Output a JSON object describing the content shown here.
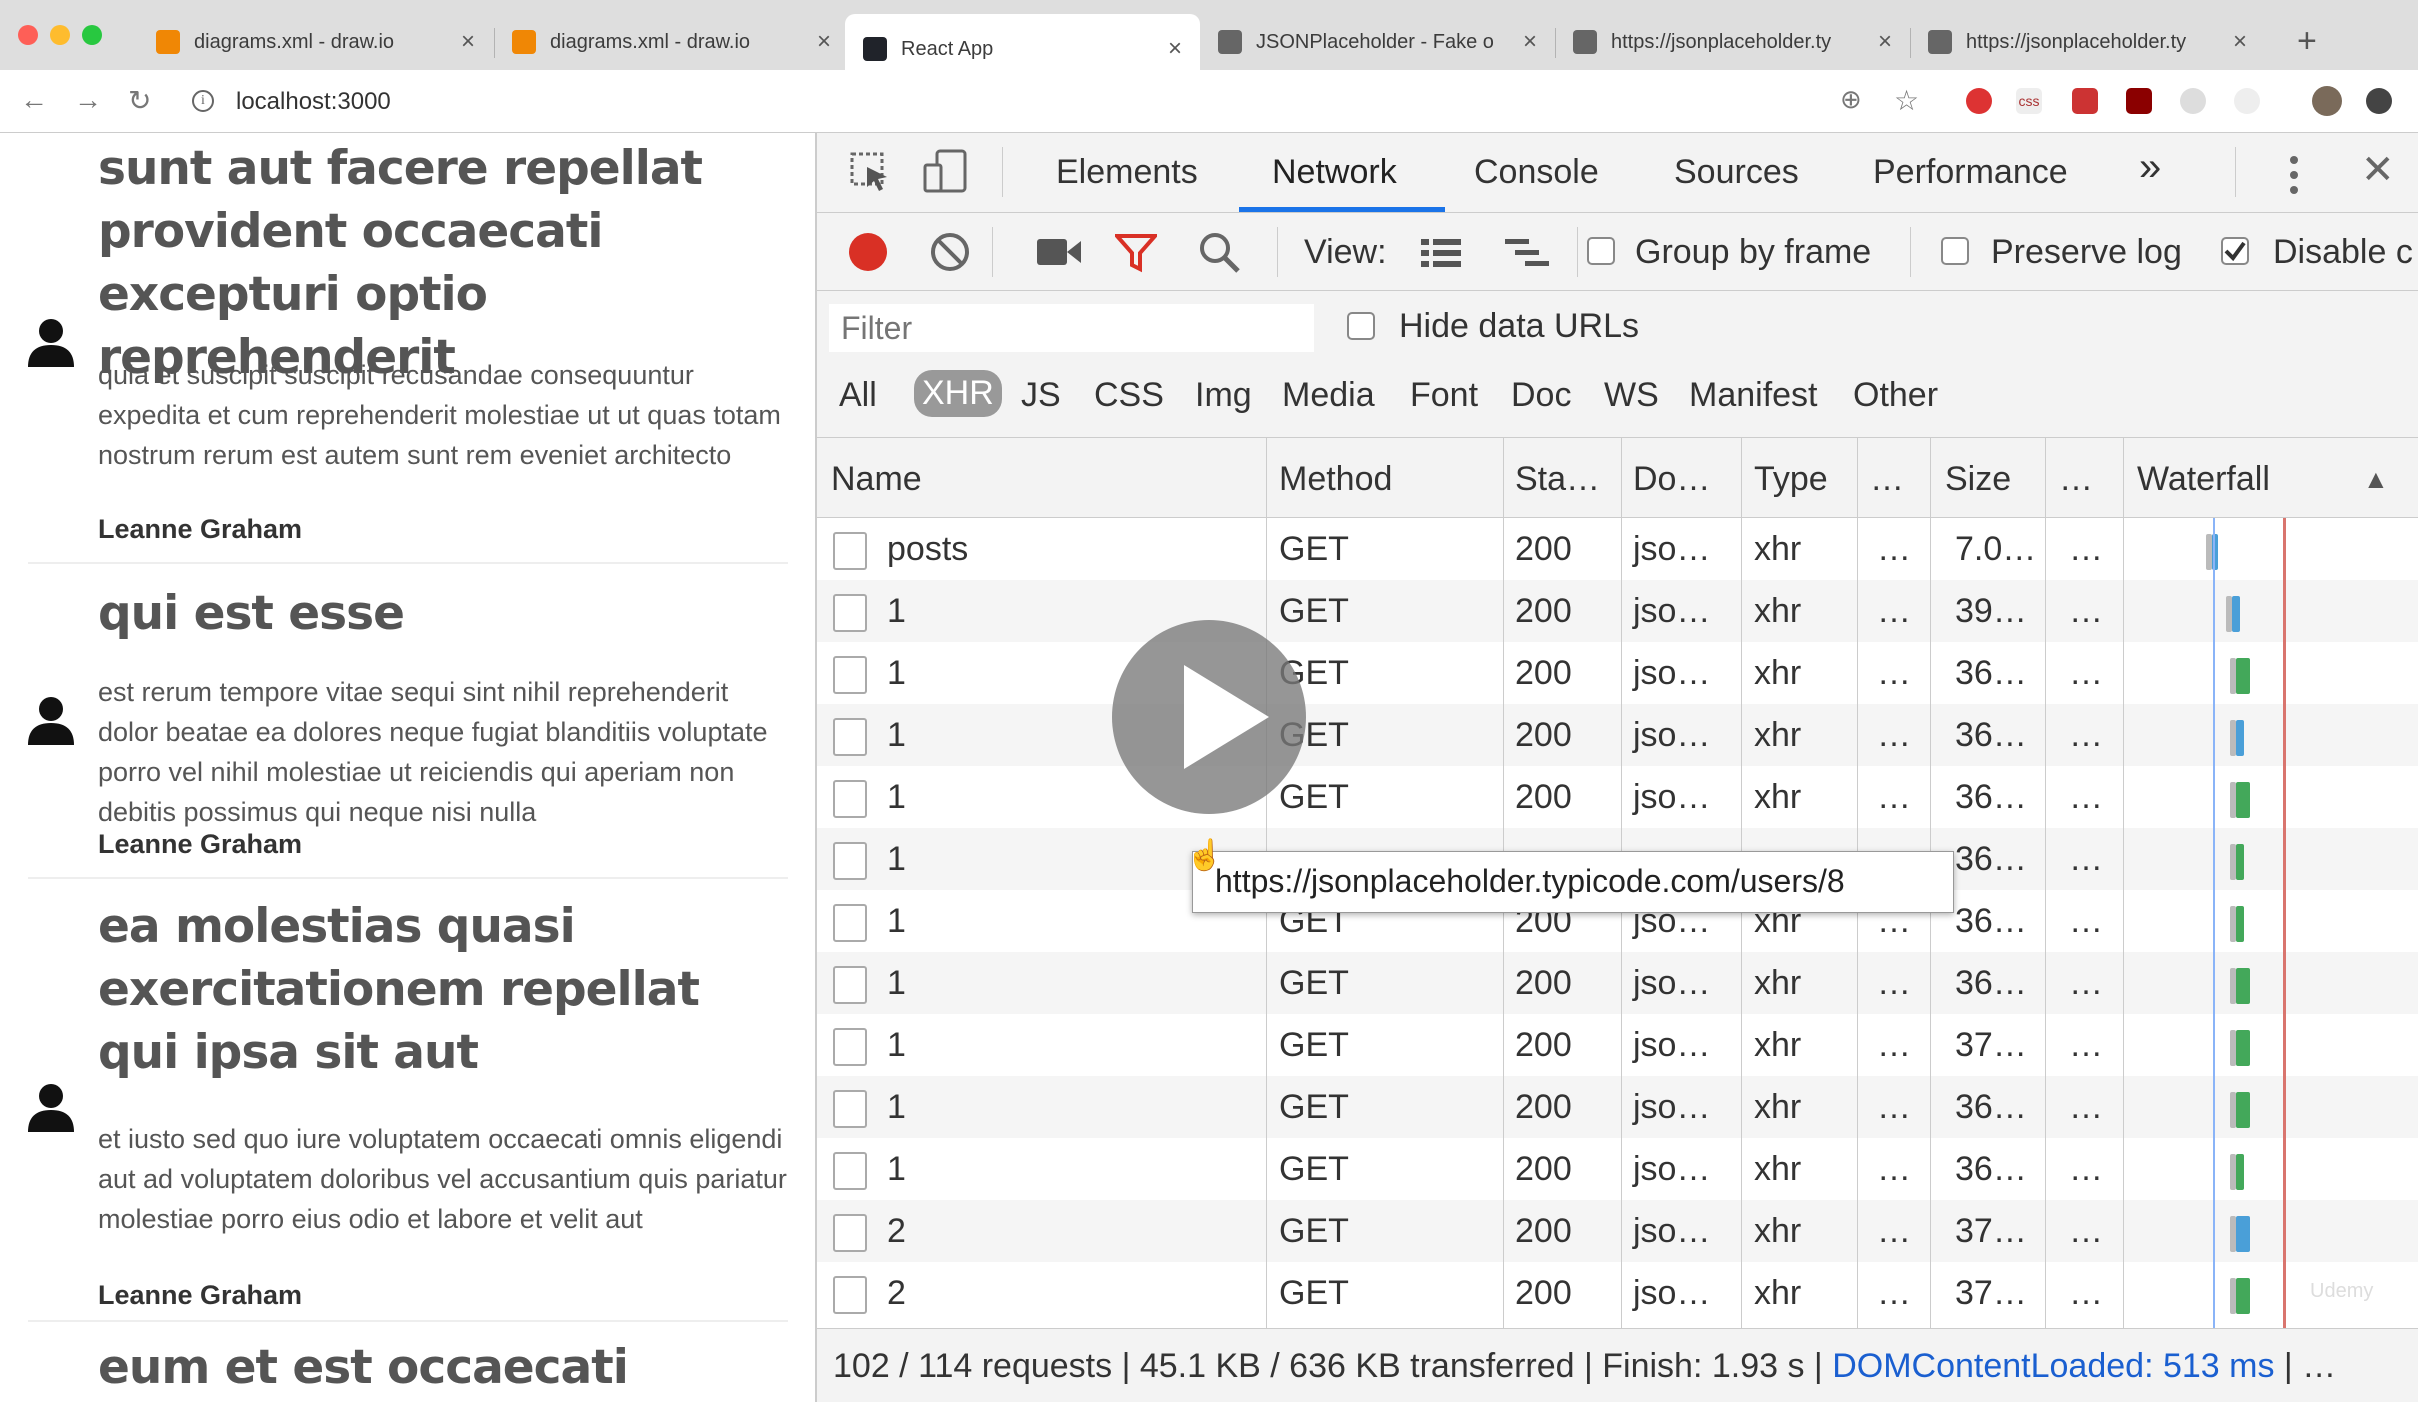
{
  "browser": {
    "tabs": [
      {
        "title": "diagrams.xml - draw.io",
        "icon": "drawio-icon",
        "color": "#f08705"
      },
      {
        "title": "diagrams.xml - draw.io",
        "icon": "drawio-icon",
        "color": "#f08705"
      },
      {
        "title": "React App",
        "icon": "react-icon",
        "color": "#20232a",
        "active": true
      },
      {
        "title": "JSONPlaceholder - Fake o",
        "icon": "placeholder-icon",
        "color": "#666"
      },
      {
        "title": "https://jsonplaceholder.ty",
        "icon": "placeholder-icon",
        "color": "#666"
      },
      {
        "title": "https://jsonplaceholder.ty",
        "icon": "placeholder-icon",
        "color": "#666"
      }
    ],
    "url": "localhost:3000"
  },
  "posts": [
    {
      "title": "sunt aut facere repellat provident occaecati excepturi optio reprehenderit",
      "body": "quia et suscipit suscipit recusandae consequuntur expedita et cum reprehenderit molestiae ut ut quas totam nostrum rerum est autem sunt rem eveniet architecto",
      "author": "Leanne Graham"
    },
    {
      "title": "qui est esse",
      "body": "est rerum tempore vitae sequi sint nihil reprehenderit dolor beatae ea dolores neque fugiat blanditiis voluptate porro vel nihil molestiae ut reiciendis qui aperiam non debitis possimus qui neque nisi nulla",
      "author": "Leanne Graham"
    },
    {
      "title": "ea molestias quasi exercitationem repellat qui ipsa sit aut",
      "body": "et iusto sed quo iure voluptatem occaecati omnis eligendi aut ad voluptatem doloribus vel accusantium quis pariatur molestiae porro eius odio et labore et velit aut",
      "author": "Leanne Graham"
    },
    {
      "title": "eum et est occaecati",
      "body": "",
      "author": ""
    }
  ],
  "devtools": {
    "tabs": [
      "Elements",
      "Network",
      "Console",
      "Sources",
      "Performance"
    ],
    "more": "»",
    "toolbar": {
      "view_label": "View:",
      "group_by_frame": "Group by frame",
      "preserve_log": "Preserve log",
      "disable_cache": "Disable c"
    },
    "filter_placeholder": "Filter",
    "hide_data_urls": "Hide data URLs",
    "types": [
      "All",
      "XHR",
      "JS",
      "CSS",
      "Img",
      "Media",
      "Font",
      "Doc",
      "WS",
      "Manifest",
      "Other"
    ],
    "columns": [
      "Name",
      "Method",
      "Sta…",
      "Do…",
      "Type",
      "…",
      "Size",
      "…",
      "Waterfall"
    ],
    "rows": [
      {
        "name": "posts",
        "method": "GET",
        "status": "200",
        "domain": "jso…",
        "type": "xhr",
        "c6": "…",
        "size": "7.0…",
        "c8": "…"
      },
      {
        "name": "1",
        "method": "GET",
        "status": "200",
        "domain": "jso…",
        "type": "xhr",
        "c6": "…",
        "size": "39…",
        "c8": "…"
      },
      {
        "name": "1",
        "method": "GET",
        "status": "200",
        "domain": "jso…",
        "type": "xhr",
        "c6": "…",
        "size": "36…",
        "c8": "…"
      },
      {
        "name": "1",
        "method": "GET",
        "status": "200",
        "domain": "jso…",
        "type": "xhr",
        "c6": "…",
        "size": "36…",
        "c8": "…"
      },
      {
        "name": "1",
        "method": "GET",
        "status": "200",
        "domain": "jso…",
        "type": "xhr",
        "c6": "…",
        "size": "36…",
        "c8": "…"
      },
      {
        "name": "1",
        "method": "",
        "status": "",
        "domain": "",
        "type": "",
        "c6": "",
        "size": "36…",
        "c8": "…"
      },
      {
        "name": "1",
        "method": "GET",
        "status": "200",
        "domain": "jso…",
        "type": "xhr",
        "c6": "…",
        "size": "36…",
        "c8": "…"
      },
      {
        "name": "1",
        "method": "GET",
        "status": "200",
        "domain": "jso…",
        "type": "xhr",
        "c6": "…",
        "size": "36…",
        "c8": "…"
      },
      {
        "name": "1",
        "method": "GET",
        "status": "200",
        "domain": "jso…",
        "type": "xhr",
        "c6": "…",
        "size": "37…",
        "c8": "…"
      },
      {
        "name": "1",
        "method": "GET",
        "status": "200",
        "domain": "jso…",
        "type": "xhr",
        "c6": "…",
        "size": "36…",
        "c8": "…"
      },
      {
        "name": "1",
        "method": "GET",
        "status": "200",
        "domain": "jso…",
        "type": "xhr",
        "c6": "…",
        "size": "36…",
        "c8": "…"
      },
      {
        "name": "2",
        "method": "GET",
        "status": "200",
        "domain": "jso…",
        "type": "xhr",
        "c6": "…",
        "size": "37…",
        "c8": "…"
      },
      {
        "name": "2",
        "method": "GET",
        "status": "200",
        "domain": "jso…",
        "type": "xhr",
        "c6": "…",
        "size": "37…",
        "c8": "…"
      }
    ],
    "status": {
      "summary": "102 / 114 requests | 45.1 KB / 636 KB transferred | Finish: 1.93 s | ",
      "dcl": "DOMContentLoaded: 513 ms",
      "tail": " | …"
    },
    "tooltip": "https://jsonplaceholder.typicode.com/users/8"
  },
  "colors": {
    "record": "#d93025",
    "filter_funnel": "#d93025",
    "waterfall_blue": "#4a9fd8",
    "waterfall_green": "#43a85a",
    "accent": "#1a73e8"
  },
  "watermark": "Udemy"
}
